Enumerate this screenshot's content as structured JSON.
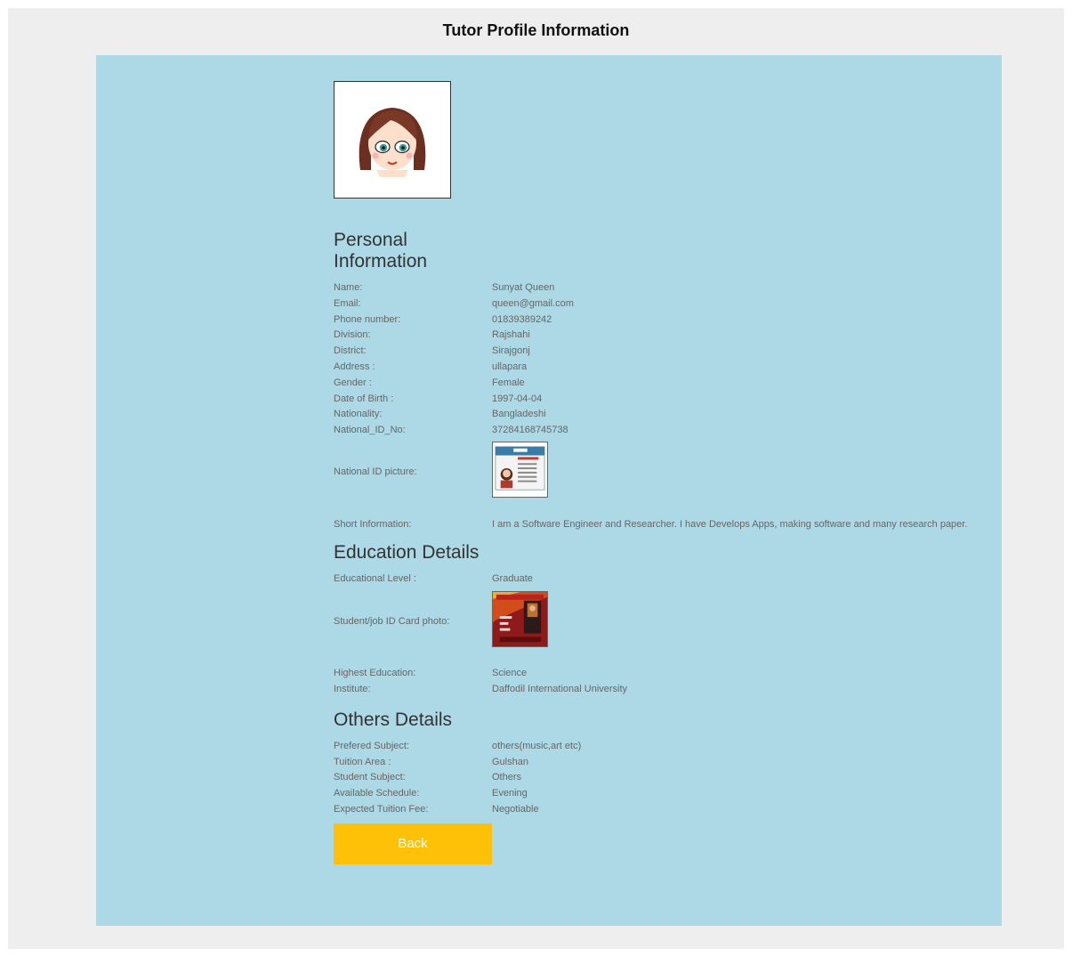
{
  "header": {
    "title": "Tutor Profile Information"
  },
  "personal": {
    "title": "Personal Information",
    "fields": [
      {
        "label": "Name:",
        "value": "Sunyat Queen"
      },
      {
        "label": "Email:",
        "value": "queen@gmail.com"
      },
      {
        "label": "Phone number:",
        "value": "01839389242"
      },
      {
        "label": "Division:",
        "value": "Rajshahi"
      },
      {
        "label": "District:",
        "value": "Sirajgonj"
      },
      {
        "label": "Address :",
        "value": "ullapara"
      },
      {
        "label": "Gender :",
        "value": "Female"
      },
      {
        "label": "Date of Birth :",
        "value": "1997-04-04"
      },
      {
        "label": "Nationality:",
        "value": "Bangladeshi"
      },
      {
        "label": "National_ID_No:",
        "value": "37284168745738"
      }
    ],
    "nid_picture_label": "National ID picture:",
    "short_info_label": "Short Information:",
    "short_info_value": "I am a Software Engineer and Researcher. I have Develops Apps, making software and many research paper."
  },
  "education": {
    "title": "Education Details",
    "level_label": "Educational Level :",
    "level_value": "Graduate",
    "id_card_label": "Student/job ID Card photo:",
    "fields": [
      {
        "label": "Highest Education:",
        "value": "Science"
      },
      {
        "label": "Institute:",
        "value": "Daffodil International University"
      }
    ]
  },
  "others": {
    "title": "Others Details",
    "fields": [
      {
        "label": "Prefered Subject:",
        "value": "others(music,art etc)"
      },
      {
        "label": "Tuition Area :",
        "value": "Gulshan"
      },
      {
        "label": "Student Subject:",
        "value": "Others"
      },
      {
        "label": "Available Schedule:",
        "value": "Evening"
      },
      {
        "label": "Expected Tuition Fee:",
        "value": "Negotiable"
      }
    ]
  },
  "actions": {
    "back_label": "Back"
  },
  "colors": {
    "page_background": "#eeeeee",
    "panel_background": "#add8e6",
    "back_button": "#ffc107"
  },
  "icons": {
    "avatar": "cartoon-girl-avatar",
    "nid": "id-card-image",
    "student_card": "student-card-image"
  }
}
